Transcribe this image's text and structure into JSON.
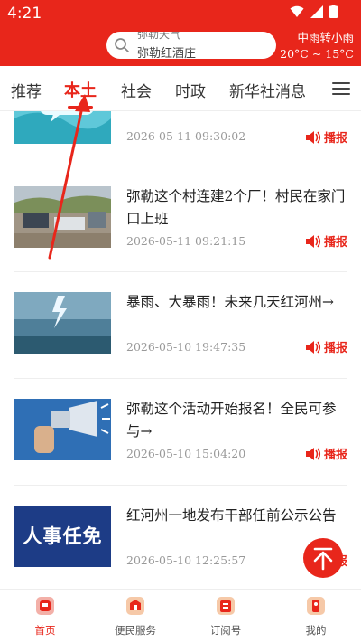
{
  "status": {
    "time": "4:21"
  },
  "search": {
    "hint_top": "弥勒天气",
    "placeholder": "弥勒红酒庄"
  },
  "weather": {
    "condition": "中雨转小雨",
    "temp": "20°C ~ 15°C"
  },
  "tabs": [
    {
      "label": "推荐"
    },
    {
      "label": "本土"
    },
    {
      "label": "社会"
    },
    {
      "label": "时政"
    },
    {
      "label": "新华社消息"
    }
  ],
  "feed": [
    {
      "title": "→",
      "date": "2026-05-11 09:30:02",
      "action": "播报"
    },
    {
      "title": "弥勒这个村连建2个厂！村民在家门口上班",
      "date": "2026-05-11 09:21:15",
      "action": "播报"
    },
    {
      "title": "暴雨、大暴雨！未来几天红河州→",
      "date": "2026-05-10 19:47:35",
      "action": "播报"
    },
    {
      "title": "弥勒这个活动开始报名！全民可参与→",
      "date": "2026-05-10 15:04:20",
      "action": "播报"
    },
    {
      "title": "红河州一地发布干部任前公示公告",
      "date": "2026-05-10 12:25:57",
      "action": "播报",
      "thumb_text": "人事任免"
    }
  ],
  "bottom_nav": [
    {
      "label": "首页"
    },
    {
      "label": "便民服务"
    },
    {
      "label": "订阅号"
    },
    {
      "label": "我的"
    }
  ],
  "colors": {
    "brand": "#e8261b",
    "text": "#222222",
    "muted": "#999999"
  }
}
